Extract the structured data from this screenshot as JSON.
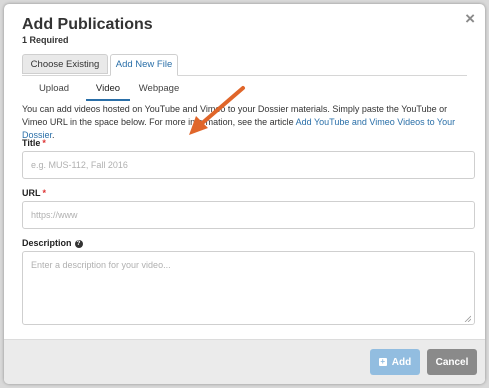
{
  "modal": {
    "title": "Add Publications",
    "subtitle": "1 Required",
    "close_icon": "×"
  },
  "tabs": {
    "choose_existing": "Choose Existing",
    "add_new_file": "Add New File"
  },
  "subtabs": {
    "upload": "Upload",
    "video": "Video",
    "webpage": "Webpage"
  },
  "description": {
    "text": "You can add videos hosted on YouTube and Vimeo to your Dossier materials. Simply paste the YouTube or Vimeo URL in the space below. For more information, see the article ",
    "link": "Add YouTube and Vimeo Videos to Your Dossier",
    "suffix": "."
  },
  "fields": {
    "title": {
      "label": "Title",
      "required": "*",
      "placeholder": "e.g. MUS-112, Fall 2016"
    },
    "url": {
      "label": "URL",
      "required": "*",
      "placeholder": "https://www"
    },
    "description": {
      "label": "Description",
      "help_icon": "?",
      "placeholder": "Enter a description for your video..."
    }
  },
  "footer": {
    "add_label": "Add",
    "cancel_label": "Cancel"
  },
  "colors": {
    "accent": "#2a6fa8",
    "add_button": "#92bde0",
    "cancel_button": "#8a8a8a",
    "annotation_arrow": "#e0662a"
  },
  "icons": {
    "close": "close-icon",
    "help": "question-circle-icon",
    "add": "plus-square-icon",
    "arrow": "annotation-arrow-icon"
  }
}
